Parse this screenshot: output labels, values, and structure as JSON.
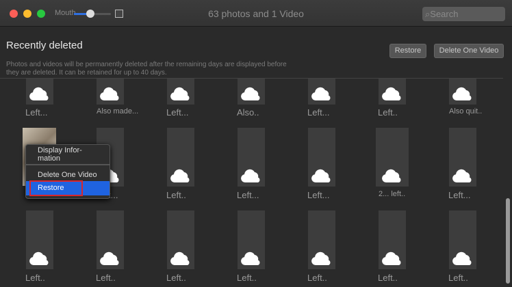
{
  "window": {
    "title": "63 photos and 1 Video",
    "slider_label": "Mouth",
    "slider_value": 0.45,
    "search_placeholder": "Search"
  },
  "header": {
    "title": "Recently deleted",
    "description": "Photos and videos will be permanently deleted after the remaining days are displayed before they are deleted. It can be retained for up to 40 days.",
    "restore_label": "Restore",
    "delete_label": "Delete One Video"
  },
  "grid": {
    "rows": [
      [
        "Left...",
        "Also made...",
        "Left...",
        "Also..",
        "Left...",
        "Left..",
        "Also quit.."
      ],
      [
        "...ll...",
        "Left...",
        "Left..",
        "Left...",
        "Left...",
        "2... left..",
        "Left..."
      ],
      [
        "Left..",
        "Left..",
        "Left..",
        "Left..",
        "Left..",
        "Left..",
        "Left.."
      ]
    ]
  },
  "context_menu": {
    "items": [
      "Display Infor-mation",
      "Delete One Video",
      "Restore"
    ],
    "highlighted": "Restore"
  },
  "colors": {
    "accent": "#2f6fe0",
    "highlight_box": "#d9262b"
  }
}
